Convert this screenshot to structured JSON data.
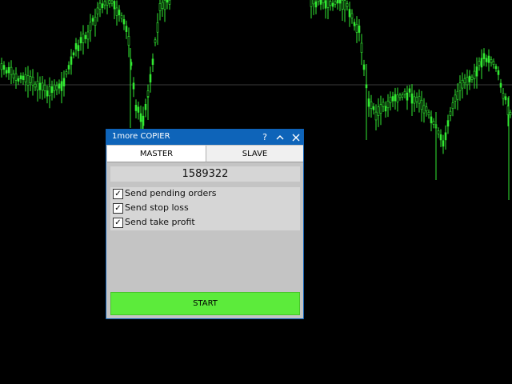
{
  "window": {
    "title": "1more COPIER",
    "help_label": "?",
    "minimize_label": "^",
    "close_label": "✕"
  },
  "tabs": [
    {
      "label": "MASTER",
      "active": true
    },
    {
      "label": "SLAVE",
      "active": false
    }
  ],
  "account_number": "1589322",
  "options": [
    {
      "label": "Send pending orders",
      "checked": true
    },
    {
      "label": "Send stop loss",
      "checked": true
    },
    {
      "label": "Send take profit",
      "checked": true
    }
  ],
  "start_label": "START",
  "colors": {
    "titlebar": "#0e64b9",
    "start_button": "#5ceb3b",
    "chart_bars": "#32e832",
    "background": "#000000"
  }
}
